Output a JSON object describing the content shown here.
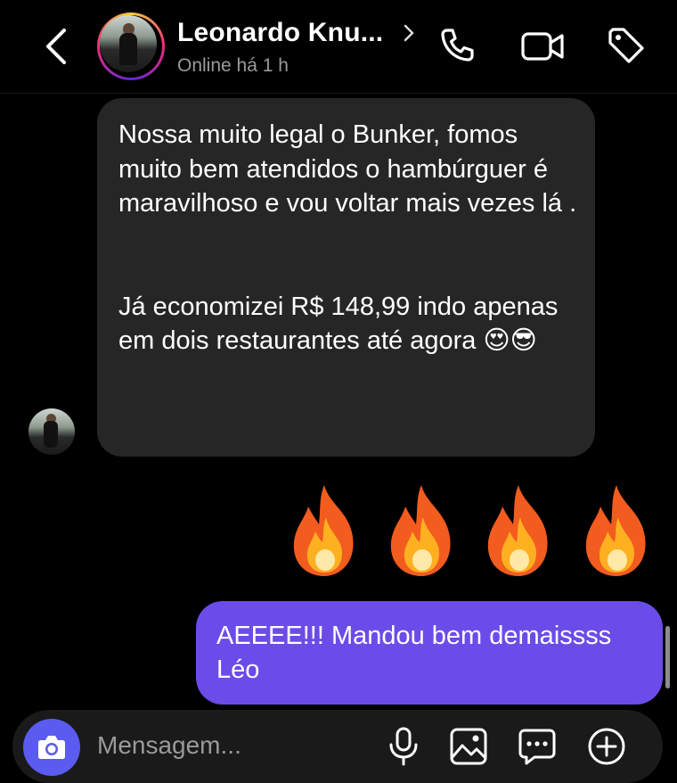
{
  "header": {
    "contact_name": "Leonardo Knu...",
    "status": "Online há 1 h",
    "icons": [
      "back-chevron-icon",
      "chevron-right-icon",
      "phone-icon",
      "video-camera-icon",
      "tag-icon"
    ]
  },
  "messages": [
    {
      "direction": "incoming",
      "text": "Nossa muito legal o Bunker, fomos muito bem atendidos o hambúrguer é maravilhoso e vou voltar mais vezes lá .\n\n\nJá economizei R$ 148,99 indo apenas em dois restaurantes até agora 😍😎"
    },
    {
      "direction": "outgoing",
      "type": "emoji",
      "text": "🔥🔥🔥🔥"
    },
    {
      "direction": "outgoing",
      "text": "AEEEE!!! Mandou bem demaissss Léo"
    }
  ],
  "composer": {
    "placeholder": "Mensagem...",
    "icons": [
      "camera-icon",
      "microphone-icon",
      "gallery-icon",
      "sticker-icon",
      "add-icon"
    ]
  },
  "colors": {
    "background": "#000000",
    "incoming_bubble": "#262626",
    "outgoing_bubble": "#6b4ce8",
    "camera_button": "#5b5bf0"
  }
}
